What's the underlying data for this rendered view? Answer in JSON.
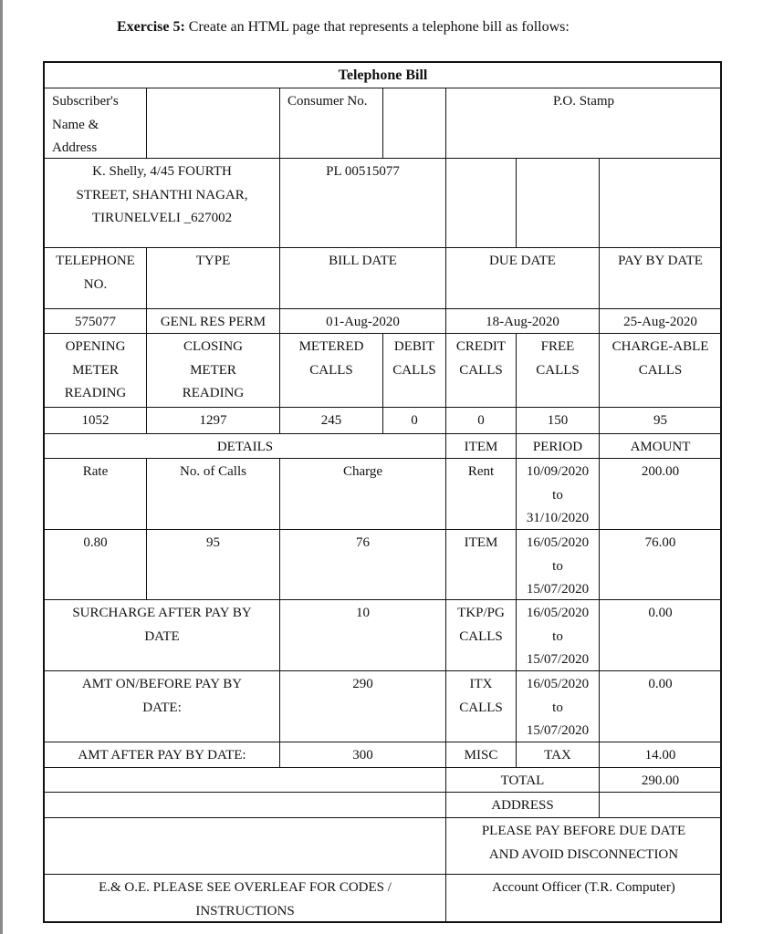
{
  "heading": {
    "label": "Exercise 5:",
    "text": " Create an HTML page that represents a telephone bill as follows:"
  },
  "bill": {
    "title": "Telephone Bill",
    "subscriber_label": [
      "Subscriber's",
      "Name &",
      "Address"
    ],
    "subscriber_value": "",
    "consumer_label": "Consumer No.",
    "consumer_blank": "",
    "po_stamp": "P.O. Stamp",
    "address": [
      "K. Shelly, 4/45 FOURTH",
      "STREET, SHANTHI NAGAR,",
      "TIRUNELVELI _627002"
    ],
    "consumer_no": "PL 00515077",
    "headers": {
      "telephone_no": [
        "TELEPHONE",
        "NO."
      ],
      "type": "TYPE",
      "bill_date": "BILL DATE",
      "due_date": "DUE DATE",
      "pay_by_date": "PAY BY DATE"
    },
    "values": {
      "telephone_no": "575077",
      "type": "GENL RES PERM",
      "bill_date": "01-Aug-2020",
      "due_date": "18-Aug-2020",
      "pay_by_date": "25-Aug-2020"
    },
    "meter_headers": {
      "opening": [
        "OPENING",
        "METER",
        "READING"
      ],
      "closing": [
        "CLOSING",
        "METER",
        "READING"
      ],
      "metered": [
        "METERED",
        "CALLS"
      ],
      "debit": [
        "DEBIT",
        "CALLS"
      ],
      "credit": [
        "CREDIT",
        "CALLS"
      ],
      "free": [
        "FREE",
        "CALLS"
      ],
      "chargeable": [
        "CHARGE-ABLE",
        "CALLS"
      ]
    },
    "meter_values": {
      "opening": "1052",
      "closing": "1297",
      "metered": "245",
      "debit": "0",
      "credit": "0",
      "free": "150",
      "chargeable": "95"
    },
    "details": {
      "details_label": "DETAILS",
      "item_label": "ITEM",
      "period_label": "PERIOD",
      "amount_label": "AMOUNT",
      "rate_label": "Rate",
      "calls_label": "No. of Calls",
      "charge_label": "Charge",
      "rate": "0.80",
      "calls": "95",
      "charge": "76"
    },
    "items": [
      {
        "item": [
          "Rent"
        ],
        "period": [
          "10/09/2020",
          "to",
          "31/10/2020"
        ],
        "amount": "200.00"
      },
      {
        "item": [
          "ITEM"
        ],
        "period": [
          "16/05/2020",
          "to",
          "15/07/2020"
        ],
        "amount": "76.00"
      },
      {
        "item": [
          "TKP/PG",
          "CALLS"
        ],
        "period": [
          "16/05/2020",
          "to",
          "15/07/2020"
        ],
        "amount": "0.00"
      },
      {
        "item": [
          "ITX",
          "CALLS"
        ],
        "period": [
          "16/05/2020",
          "to",
          "15/07/2020"
        ],
        "amount": "0.00"
      },
      {
        "item": [
          "MISC"
        ],
        "period": [
          "TAX"
        ],
        "amount": "14.00"
      }
    ],
    "summary": {
      "surcharge_label": [
        "SURCHARGE AFTER PAY BY",
        "DATE"
      ],
      "surcharge": "10",
      "amt_before_label": [
        "AMT ON/BEFORE PAY BY",
        "DATE:"
      ],
      "amt_before": "290",
      "amt_after_label": "AMT AFTER PAY BY DATE:",
      "amt_after": "300"
    },
    "total_label": "TOTAL",
    "total": "290.00",
    "address_label": "ADDRESS",
    "address_value": "",
    "notice": [
      "PLEASE PAY BEFORE DUE DATE",
      "AND AVOID DISCONNECTION"
    ],
    "footer_note": [
      "E.& O.E. PLEASE SEE OVERLEAF FOR CODES /",
      "INSTRUCTIONS"
    ],
    "officer": "Account Officer (T.R. Computer)"
  }
}
